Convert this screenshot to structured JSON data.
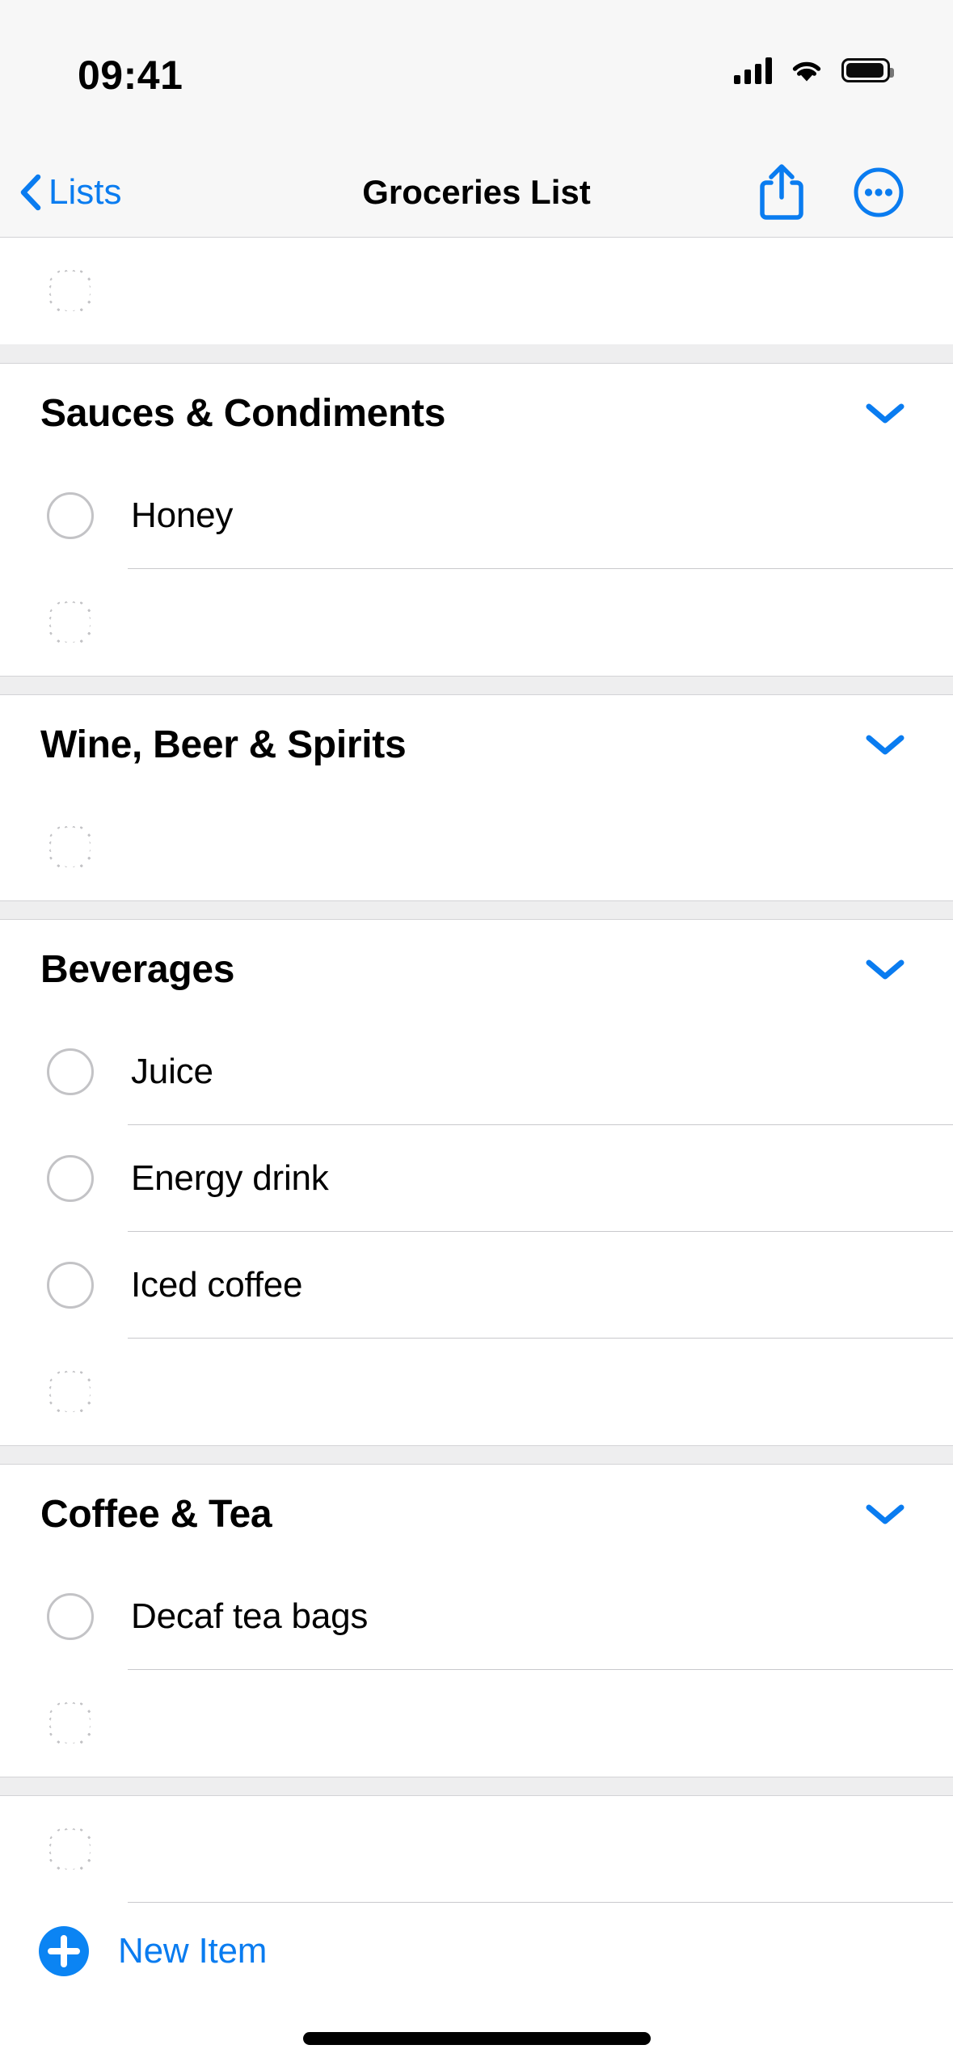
{
  "status_bar": {
    "time": "09:41",
    "cellular_icon": "signal-bars-icon",
    "wifi_icon": "wifi-icon",
    "battery_icon": "battery-full-icon",
    "signal_bars": 4,
    "battery_level": 100
  },
  "nav_bar": {
    "back_label": "Lists",
    "back_icon": "chevron-left-icon",
    "title": "Groceries List",
    "share_icon": "share-icon",
    "more_icon": "ellipsis-circle-icon"
  },
  "colors": {
    "accent_blue": "#0a7cf0",
    "plus_blue": "#0b84f3",
    "circle_gray": "#c3c3c6",
    "separator": "#c9c9cc",
    "section_gap": "#eeeeef",
    "bar_background": "#f7f7f7"
  },
  "top_placeholder": {
    "checkbox_icon": "dotted-circle-icon"
  },
  "sections": [
    {
      "title": "Sauces & Condiments",
      "collapse_icon": "chevron-down-icon",
      "items": [
        {
          "label": "Honey",
          "checkbox_icon": "circle-icon",
          "checked": false
        }
      ],
      "placeholder": {
        "checkbox_icon": "dotted-circle-icon"
      }
    },
    {
      "title": "Wine, Beer & Spirits",
      "collapse_icon": "chevron-down-icon",
      "items": [],
      "placeholder": {
        "checkbox_icon": "dotted-circle-icon"
      }
    },
    {
      "title": "Beverages",
      "collapse_icon": "chevron-down-icon",
      "items": [
        {
          "label": "Juice",
          "checkbox_icon": "circle-icon",
          "checked": false
        },
        {
          "label": "Energy drink",
          "checkbox_icon": "circle-icon",
          "checked": false
        },
        {
          "label": "Iced coffee",
          "checkbox_icon": "circle-icon",
          "checked": false
        }
      ],
      "placeholder": {
        "checkbox_icon": "dotted-circle-icon"
      }
    },
    {
      "title": "Coffee & Tea",
      "collapse_icon": "chevron-down-icon",
      "items": [
        {
          "label": "Decaf tea bags",
          "checkbox_icon": "circle-icon",
          "checked": false
        }
      ],
      "placeholder": {
        "checkbox_icon": "dotted-circle-icon"
      }
    }
  ],
  "footer": {
    "placeholder": {
      "checkbox_icon": "dotted-circle-icon"
    },
    "new_item_label": "New Item",
    "new_item_icon": "plus-circle-icon"
  },
  "home_indicator": "home-indicator"
}
